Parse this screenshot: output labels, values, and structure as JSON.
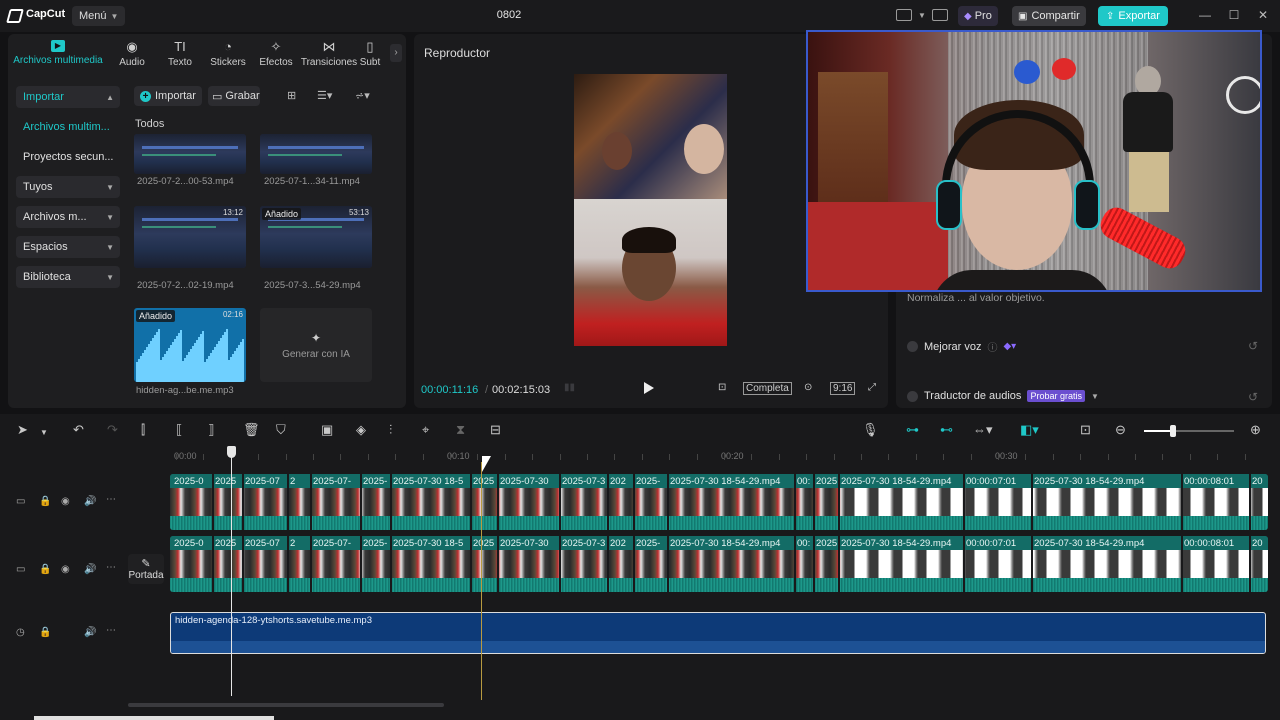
{
  "app": {
    "brand": "CapCut",
    "menu_label": "Menú",
    "project_title": "0802",
    "pro_label": "Pro",
    "share_label": "Compartir",
    "export_label": "Exportar",
    "accent_color": "#1fc8c8"
  },
  "media_tabs": [
    {
      "label": "Archivos multimedia",
      "icon": "media-icon",
      "active": true
    },
    {
      "label": "Audio",
      "icon": "audio-icon"
    },
    {
      "label": "Texto",
      "icon": "text-icon"
    },
    {
      "label": "Stickers",
      "icon": "sticker-icon"
    },
    {
      "label": "Efectos",
      "icon": "effects-icon"
    },
    {
      "label": "Transiciones",
      "icon": "transitions-icon"
    },
    {
      "label": "Subt",
      "icon": "subtitles-icon"
    }
  ],
  "side_nav": [
    {
      "label": "Importar"
    },
    {
      "label": "Archivos multim..."
    },
    {
      "label": "Proyectos secun..."
    },
    {
      "label": "Tuyos"
    },
    {
      "label": "Archivos m..."
    },
    {
      "label": "Espacios"
    },
    {
      "label": "Biblioteca"
    }
  ],
  "media_toolbar": {
    "import_label": "Importar",
    "record_label": "Grabar"
  },
  "media_section": "Todos",
  "media_items": [
    {
      "label": "2025-07-2...00-53.mp4"
    },
    {
      "label": "2025-07-1...34-11.mp4"
    },
    {
      "label": "2025-07-2...02-19.mp4",
      "time": "13:12"
    },
    {
      "label": "2025-07-3...54-29.mp4",
      "badge": "Añadido",
      "time": "53:13"
    },
    {
      "label": "hidden-ag...be.me.mp3",
      "badge": "Añadido",
      "time": "02:16"
    }
  ],
  "generate_ai_label": "Generar con IA",
  "player": {
    "title": "Reproductor",
    "current_time": "00:00:11:16",
    "total_time": "00:02:15:03",
    "ratio_label": "Completa",
    "aspect": "9:16"
  },
  "right_panel": {
    "normalize_text": "Normaliza ... al valor objetivo.",
    "enhance_voice": "Mejorar voz",
    "translator": "Traductor de audios",
    "translator_badge": "Probar gratis"
  },
  "timeline": {
    "ruler": [
      "00:00",
      "00:10",
      "00:20",
      "00:30"
    ],
    "cover_label": "Portada",
    "video_clips_top": [
      "2025-0",
      "2025",
      "2025-07",
      "2",
      "2025-07-",
      "2025-",
      "2025-07-30 18-5",
      "2025",
      "2025-07-30",
      "2025-07-3",
      "202",
      "2025-",
      "2025-07-30 18-54-29.mp4",
      "00:",
      "2025",
      "2025-07-30 18-54-29.mp4",
      "00:00:07:01",
      "2025-07-30 18-54-29.mp4",
      "00:00:08:01",
      "20"
    ],
    "audio_clip": "hidden-agenda-128-ytshorts.savetube.me.mp3"
  }
}
